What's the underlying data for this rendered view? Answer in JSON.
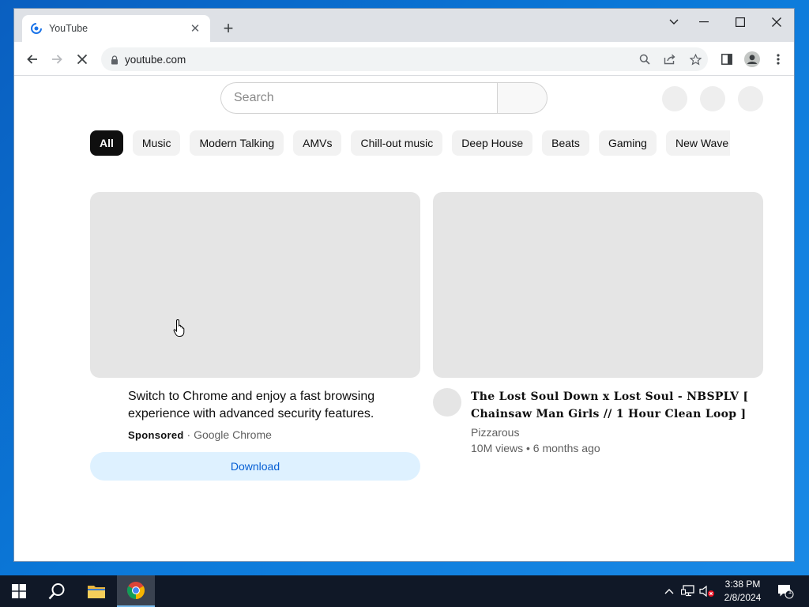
{
  "browser": {
    "tab": {
      "title": "YouTube"
    },
    "address_bar": {
      "url": "youtube.com"
    }
  },
  "page": {
    "search": {
      "placeholder": "Search"
    },
    "chips": [
      "All",
      "Music",
      "Modern Talking",
      "AMVs",
      "Chill-out music",
      "Deep House",
      "Beats",
      "Gaming",
      "New Wave"
    ],
    "ad_card": {
      "title": "Switch to Chrome and enjoy a fast browsing experience with advanced security features.",
      "sponsored_label": "Sponsored",
      "separator": "·",
      "advertiser": "Google Chrome",
      "cta": "Download"
    },
    "video_card": {
      "title": "The Lost Soul Down x Lost Soul - NBSPLV [ Chainsaw Man Girls // 1 Hour Clean Loop ]",
      "channel": "Pizzarous",
      "stats": "10M views • 6 months ago"
    }
  },
  "taskbar": {
    "time": "3:38 PM",
    "date": "2/8/2024",
    "notification_count": "1"
  },
  "colors": {
    "accent_blue": "#065fd4",
    "download_bg": "#def1ff",
    "chip_active_bg": "#0f0f0f",
    "chip_bg": "#f2f2f2",
    "placeholder_gray": "#e5e5e5"
  }
}
